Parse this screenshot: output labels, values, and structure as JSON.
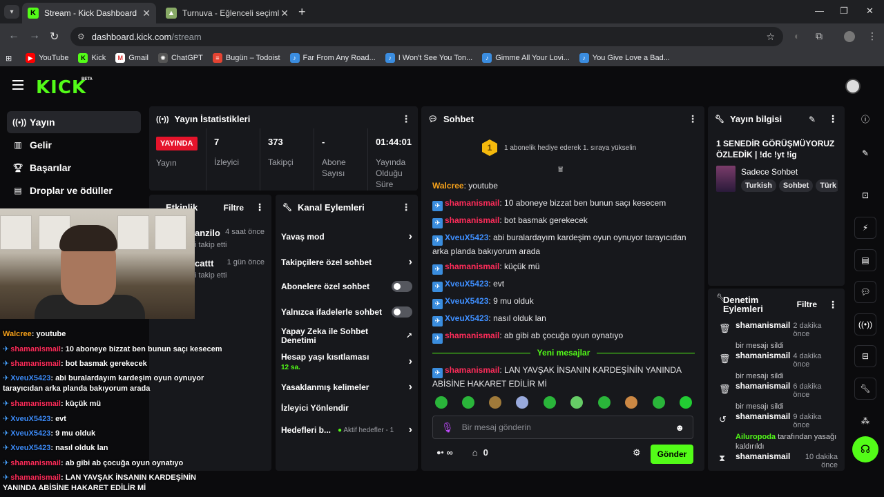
{
  "browser": {
    "tabs": [
      {
        "title": "Stream - Kick Dashboard",
        "active": true
      },
      {
        "title": "Turnuva - Eğlenceli seçimler ya",
        "active": false
      }
    ],
    "url_host": "dashboard.kick.com",
    "url_path": "/stream",
    "bookmarks": [
      "YouTube",
      "Kick",
      "Gmail",
      "ChatGPT",
      "Bugün – Todoist",
      "Far From Any Road...",
      "I Won't See You Ton...",
      "Gimme All Your Lovi...",
      "You Give Love a Bad..."
    ]
  },
  "app": {
    "logo": "KICK",
    "beta": "BETA",
    "accent": "#53fc18"
  },
  "sidebar": {
    "items": [
      {
        "label": "Yayın",
        "icon": "broadcast-icon",
        "active": true
      },
      {
        "label": "Gelir",
        "icon": "chart-icon",
        "active": false
      },
      {
        "label": "Başarılar",
        "icon": "trophy-icon",
        "active": false
      },
      {
        "label": "Droplar ve ödüller",
        "icon": "gift-icon",
        "active": false
      }
    ]
  },
  "stats": {
    "title": "Yayın İstatistikleri",
    "live_badge": "YAYINDA",
    "live_label": "Yayın",
    "items": [
      {
        "value": "7",
        "label": "İzleyici"
      },
      {
        "value": "373",
        "label": "Takipçi"
      },
      {
        "value": "-",
        "label": "Abone Sayısı"
      },
      {
        "value": "01:44:01",
        "label": "Yayında Olduğu Süre"
      }
    ]
  },
  "activity": {
    "title": "Etkinlik",
    "filter": "Filtre",
    "items": [
      {
        "name": "anzilo",
        "time": "4 saat önce",
        "action": "i takip etti"
      },
      {
        "name": "cattt",
        "time": "1 gün önce",
        "action": "i takip etti"
      }
    ]
  },
  "actions": {
    "title": "Kanal Eylemleri",
    "items": [
      {
        "label": "Yavaş mod",
        "kind": "chevron"
      },
      {
        "label": "Takipçilere özel sohbet",
        "kind": "chevron"
      },
      {
        "label": "Abonelere özel sohbet",
        "kind": "toggle"
      },
      {
        "label": "Yalnızca ifadelerle sohbet",
        "kind": "toggle"
      },
      {
        "label": "Yapay Zeka ile Sohbet Denetimi",
        "kind": "external"
      },
      {
        "label": "Hesap yaşı kısıtlaması",
        "sub": "12 sa.",
        "kind": "chevron"
      },
      {
        "label": "Yasaklanmış kelimeler",
        "kind": "chevron"
      },
      {
        "label": "İzleyici Yönlendir",
        "kind": "none"
      },
      {
        "label": "Hedefleri b...",
        "sub": "Aktif hedefler - 1",
        "kind": "chevron"
      }
    ]
  },
  "chat": {
    "title": "Sohbet",
    "gift_rank": "1",
    "gift_text": "1 abonelik hediye ederek 1. sıraya yükselin",
    "new_messages": "Yeni mesajlar",
    "placeholder": "Bir mesaj gönderin",
    "send": "Gönder",
    "infinity": "∞",
    "count": "0",
    "messages": [
      {
        "user": "Walcree",
        "color": "orange",
        "badge": false,
        "text": "youtube"
      },
      {
        "user": "shamanismail",
        "color": "red",
        "badge": true,
        "text": "10 aboneye bizzat ben bunun saçı kesecem"
      },
      {
        "user": "shamanismail",
        "color": "red",
        "badge": true,
        "text": "bot basmak gerekecek"
      },
      {
        "user": "XveuX5423",
        "color": "blue",
        "badge": true,
        "text": "abi buralardayım kardeşim oyun oynuyor tarayıcıdan arka planda bakıyorum arada"
      },
      {
        "user": "shamanismail",
        "color": "red",
        "badge": true,
        "text": "küçük mü"
      },
      {
        "user": "XveuX5423",
        "color": "blue",
        "badge": true,
        "text": "evt"
      },
      {
        "user": "XveuX5423",
        "color": "blue",
        "badge": true,
        "text": "9 mu olduk"
      },
      {
        "user": "XveuX5423",
        "color": "blue",
        "badge": true,
        "text": "nasıl olduk lan"
      },
      {
        "user": "shamanismail",
        "color": "red",
        "badge": true,
        "text": "ab gibi ab çocuğa oyun oynatıyo"
      },
      {
        "user": "shamanismail",
        "color": "red",
        "badge": true,
        "text": "LAN YAVŞAK İNSANIN KARDEŞİNİN YANINDA ABİSİNE HAKARET EDİLİR Mİ"
      }
    ]
  },
  "stream_info": {
    "title": "Yayın bilgisi",
    "stream_title": "1 SENEDİR GÖRÜŞMÜYORUZ ÖZLEDİK | !dc !yt !ig",
    "category": "Sadece Sohbet",
    "tags": [
      "Turkish",
      "Sohbet",
      "Türk"
    ]
  },
  "moderation": {
    "title": "Denetim Eylemleri",
    "filter": "Filtre",
    "items": [
      {
        "name": "shamanismail",
        "time": "2 dakika önce",
        "desc": "bir mesajı sildi",
        "icon": "trash-icon"
      },
      {
        "name": "shamanismail",
        "time": "4 dakika önce",
        "desc": "bir mesajı sildi",
        "icon": "trash-icon"
      },
      {
        "name": "shamanismail",
        "time": "6 dakika önce",
        "desc": "bir mesajı sildi",
        "icon": "trash-icon"
      },
      {
        "name": "shamanismail",
        "time": "9 dakika önce",
        "desc_user": "Ailuropoda",
        "desc": "tarafından yasağı kaldırıldı",
        "icon": "undo-icon"
      },
      {
        "name": "shamanismail",
        "time": "10 dakika önce",
        "desc": "",
        "icon": "hourglass-icon"
      }
    ]
  },
  "overlay_chat": [
    {
      "user": "Walcree",
      "color": "orange",
      "badge": false,
      "text": "youtube"
    },
    {
      "user": "shamanismail",
      "color": "red",
      "badge": true,
      "text": "10 aboneye bizzat ben bunun saçı kesecem"
    },
    {
      "user": "shamanismail",
      "color": "red",
      "badge": true,
      "text": "bot basmak gerekecek"
    },
    {
      "user": "XveuX5423",
      "color": "blue",
      "badge": true,
      "text": "abi buralardayım kardeşim oyun oynuyor tarayıcıdan arka planda bakıyorum arada"
    },
    {
      "user": "shamanismail",
      "color": "red",
      "badge": true,
      "text": "küçük mü"
    },
    {
      "user": "XveuX5423",
      "color": "blue",
      "badge": true,
      "text": "evt"
    },
    {
      "user": "XveuX5423",
      "color": "blue",
      "badge": true,
      "text": "9 mu olduk"
    },
    {
      "user": "XveuX5423",
      "color": "blue",
      "badge": true,
      "text": "nasıl olduk lan"
    },
    {
      "user": "shamanismail",
      "color": "red",
      "badge": true,
      "text": "ab gibi ab çocuğa oyun oynatıyo"
    },
    {
      "user": "shamanismail",
      "color": "red",
      "badge": true,
      "text": "LAN YAVŞAK İNSANIN KARDEŞİNİN YANINDA ABİSİNE HAKARET EDİLİR Mİ"
    }
  ]
}
